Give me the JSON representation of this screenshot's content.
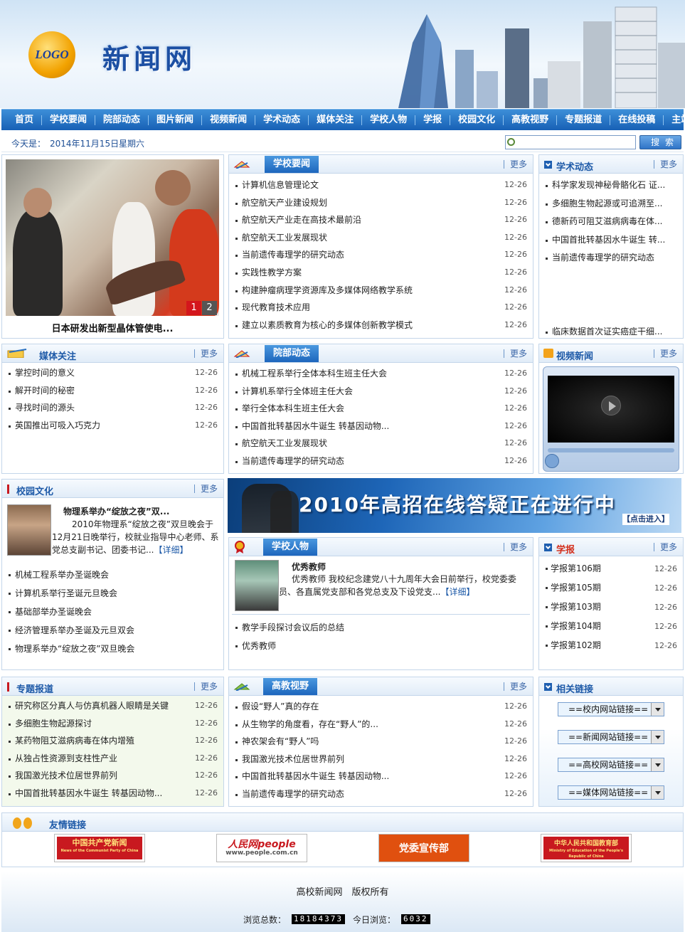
{
  "header": {
    "logo_text": "LOGO",
    "site_title": "新闻网"
  },
  "nav": [
    "首页",
    "学校要闻",
    "院部动态",
    "图片新闻",
    "视频新闻",
    "学术动态",
    "媒体关注",
    "学校人物",
    "学报",
    "校园文化",
    "高教视野",
    "专题报道",
    "在线投稿",
    "主站首页"
  ],
  "datebar": {
    "label": "今天是：",
    "date": "2014年11月15日",
    "weekday": "星期六"
  },
  "search": {
    "placeholder": "",
    "button": "搜 索"
  },
  "more_label": "更多",
  "slideshow": {
    "caption": "日本研发出新型晶体管使电...",
    "pages": [
      "1",
      "2"
    ]
  },
  "school_news": {
    "title": "学校要闻",
    "items": [
      {
        "t": "计算机信息管理论文",
        "d": "12-26"
      },
      {
        "t": "航空航天产业建设规划",
        "d": "12-26"
      },
      {
        "t": "航空航天产业走在高技术最前沿",
        "d": "12-26"
      },
      {
        "t": "航空航天工业发展现状",
        "d": "12-26"
      },
      {
        "t": "当前遗传毒理学的研究动态",
        "d": "12-26"
      },
      {
        "t": "实践性教学方案",
        "d": "12-26"
      },
      {
        "t": "构建肿瘤病理学资源库及多媒体网络教学系统",
        "d": "12-26"
      },
      {
        "t": "现代教育技术应用",
        "d": "12-26"
      },
      {
        "t": "建立以素质教育为核心的多媒体创新教学模式",
        "d": "12-26"
      }
    ]
  },
  "academic": {
    "title": "学术动态",
    "items": [
      "科学家发现神秘骨骼化石 证...",
      "多细胞生物起源或可追溯至...",
      "德新药可阻艾滋病病毒在体...",
      "中国首批转基因水牛诞生 转...",
      "当前遗传毒理学的研究动态"
    ],
    "bottom_item": "临床数据首次证实癌症干细..."
  },
  "media": {
    "title": "媒体关注",
    "items": [
      {
        "t": "掌控时间的意义",
        "d": "12-26"
      },
      {
        "t": "解开时间的秘密",
        "d": "12-26"
      },
      {
        "t": "寻找时间的源头",
        "d": "12-26"
      },
      {
        "t": "英国推出可吸入巧克力",
        "d": "12-26"
      }
    ]
  },
  "dept": {
    "title": "院部动态",
    "items": [
      {
        "t": "机械工程系举行全体本科生班主任大会",
        "d": "12-26"
      },
      {
        "t": "计算机系举行全体班主任大会",
        "d": "12-26"
      },
      {
        "t": "举行全体本科生班主任大会",
        "d": "12-26"
      },
      {
        "t": "中国首批转基因水牛诞生 转基因动物...",
        "d": "12-26"
      },
      {
        "t": "航空航天工业发展现状",
        "d": "12-26"
      },
      {
        "t": "当前遗传毒理学的研究动态",
        "d": "12-26"
      }
    ]
  },
  "video": {
    "title": "视频新闻"
  },
  "campus": {
    "title": "校园文化",
    "feature_title": "物理系举办“绽放之夜”双...",
    "feature_text": "2010年物理系“绽放之夜”双旦晚会于12月21日晚举行，校就业指导中心老师、系党总支副书记、团委书记...",
    "detail": "【详细】",
    "items": [
      "机械工程系举办圣诞晚会",
      "计算机系举行圣诞元旦晚会",
      "基础部举办圣诞晚会",
      "经济管理系举办圣诞及元旦双会",
      "物理系举办“绽放之夜”双旦晚会"
    ]
  },
  "banner": {
    "text": "2010年高招在线答疑正在进行中",
    "cta": "【点击进入】"
  },
  "people": {
    "title": "学校人物",
    "feature_title": "优秀教师",
    "feature_text": "优秀教师 我校纪念建党八十九周年大会日前举行，校党委委员、各直属党支部和各党总支及下设党支...",
    "detail": "【详细】",
    "items": [
      "教学手段探讨会议后的总结",
      "优秀教师"
    ]
  },
  "journal": {
    "title": "学报",
    "items": [
      {
        "t": "学报第106期",
        "d": "12-26"
      },
      {
        "t": "学报第105期",
        "d": "12-26"
      },
      {
        "t": "学报第103期",
        "d": "12-26"
      },
      {
        "t": "学报第104期",
        "d": "12-26"
      },
      {
        "t": "学报第102期",
        "d": "12-26"
      }
    ]
  },
  "special": {
    "title": "专题报道",
    "items": [
      {
        "t": "研究称区分真人与仿真机器人眼睛是关键",
        "d": "12-26"
      },
      {
        "t": "多细胞生物起源探讨",
        "d": "12-26"
      },
      {
        "t": "某药物阻艾滋病病毒在体内增殖",
        "d": "12-26"
      },
      {
        "t": "从独占性资源到支柱性产业",
        "d": "12-26"
      },
      {
        "t": "我国激光技术位居世界前列",
        "d": "12-26"
      },
      {
        "t": "中国首批转基因水牛诞生 转基因动物...",
        "d": "12-26"
      }
    ]
  },
  "higher_edu": {
    "title": "高教视野",
    "items": [
      {
        "t": "假设“野人”真的存在",
        "d": "12-26"
      },
      {
        "t": "从生物学的角度看，存在“野人”的...",
        "d": "12-26"
      },
      {
        "t": "神农架会有“野人”吗",
        "d": "12-26"
      },
      {
        "t": "我国激光技术位居世界前列",
        "d": "12-26"
      },
      {
        "t": "中国首批转基因水牛诞生 转基因动物...",
        "d": "12-26"
      },
      {
        "t": "当前遗传毒理学的研究动态",
        "d": "12-26"
      }
    ]
  },
  "links": {
    "title": "相关链接",
    "selects": [
      "==校内网站链接==",
      "==新闻网站链接==",
      "==高校网站链接==",
      "==媒体网站链接=="
    ]
  },
  "friends": {
    "title": "友情链接",
    "logos": [
      "中国共产党新闻",
      "人民网people",
      "党委宣传部",
      "中华人民共和国教育部"
    ],
    "sub": [
      "News of the Communist Party of China",
      "www.people.com.cn",
      "",
      "Ministry of Education of the People's Republic of China"
    ]
  },
  "footer": {
    "copyright": "高校新闻网　版权所有",
    "total_label": "浏览总数：",
    "total": "18184373",
    "today_label": "今日浏览：",
    "today": "6032"
  },
  "colors": {
    "nav": "#1e6bbf",
    "accent": "#1e5aa8",
    "red": "#c8191f"
  }
}
